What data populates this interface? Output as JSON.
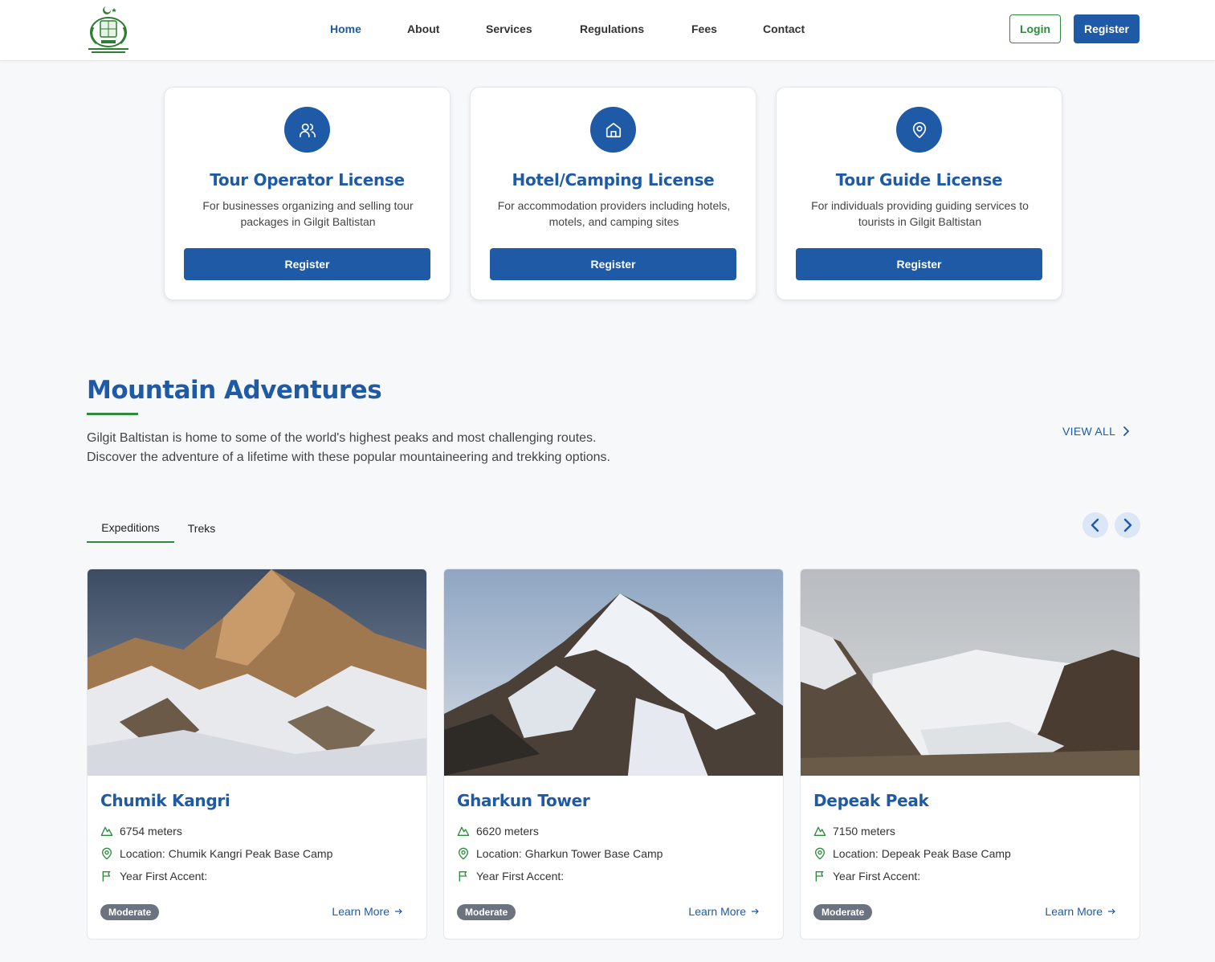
{
  "header": {
    "nav": [
      {
        "label": "Home",
        "active": true
      },
      {
        "label": "About",
        "active": false
      },
      {
        "label": "Services",
        "active": false
      },
      {
        "label": "Regulations",
        "active": false
      },
      {
        "label": "Fees",
        "active": false
      },
      {
        "label": "Contact",
        "active": false
      }
    ],
    "login_label": "Login",
    "register_label": "Register"
  },
  "licenses": [
    {
      "icon": "users-icon",
      "title": "Tour Operator License",
      "desc": "For businesses organizing and selling tour packages in Gilgit Baltistan",
      "button": "Register"
    },
    {
      "icon": "home-icon",
      "title": "Hotel/Camping License",
      "desc": "For accommodation providers including hotels, motels, and camping sites",
      "button": "Register"
    },
    {
      "icon": "map-pin-icon",
      "title": "Tour Guide License",
      "desc": "For individuals providing guiding services to tourists in Gilgit Baltistan",
      "button": "Register"
    }
  ],
  "section": {
    "title": "Mountain Adventures",
    "desc": "Gilgit Baltistan is home to some of the world's highest peaks and most challenging routes. Discover the adventure of a lifetime with these popular mountaineering and trekking options.",
    "view_all": "VIEW ALL",
    "tabs": [
      {
        "label": "Expeditions",
        "active": true
      },
      {
        "label": "Treks",
        "active": false
      }
    ]
  },
  "mountains": [
    {
      "name": "Chumik Kangri",
      "height": "6754 meters",
      "location": "Location: Chumik Kangri Peak Base Camp",
      "first_ascent": "Year First Accent:",
      "difficulty": "Moderate",
      "learn_more": "Learn More"
    },
    {
      "name": "Gharkun Tower",
      "height": "6620 meters",
      "location": "Location: Gharkun Tower Base Camp",
      "first_ascent": "Year First Accent:",
      "difficulty": "Moderate",
      "learn_more": "Learn More"
    },
    {
      "name": "Depeak Peak",
      "height": "7150 meters",
      "location": "Location: Depeak Peak Base Camp",
      "first_ascent": "Year First Accent:",
      "difficulty": "Moderate",
      "learn_more": "Learn More"
    }
  ],
  "colors": {
    "primary": "#1f5aa6",
    "accent": "#2e8b3e",
    "badge": "#6b7280"
  }
}
